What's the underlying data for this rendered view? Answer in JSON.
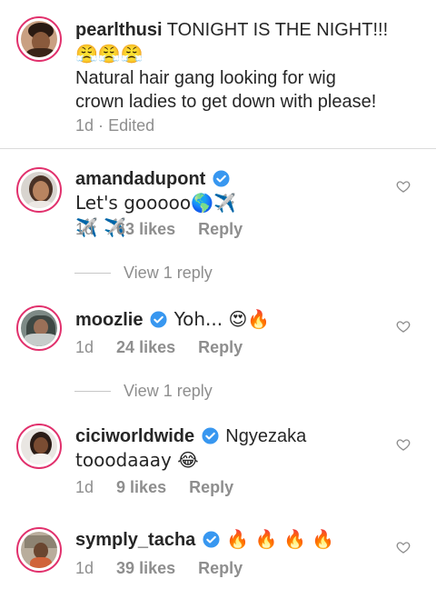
{
  "caption": {
    "username": "pearlthusi",
    "line1": "TONIGHT IS THE NIGHT!!!",
    "emojis": "😤😤😤",
    "line2": "Natural hair gang looking for wig",
    "line3": "crown ladies to get down with please!",
    "time": "1d",
    "separator": "·",
    "edited": "Edited"
  },
  "comments": [
    {
      "username": "amandadupont",
      "text1": "Let's gooooo🌎✈️",
      "text2": "✈️ ✈️",
      "time": "1d",
      "likes": "63 likes",
      "reply": "Reply",
      "view_reply": "View 1 reply"
    },
    {
      "username": "moozlie",
      "text1": "Yoh... 😍🔥",
      "time": "1d",
      "likes": "24 likes",
      "reply": "Reply",
      "view_reply": "View 1 reply"
    },
    {
      "username": "ciciworldwide",
      "text1": "Ngyezaka",
      "text2": "tooodaaay 😂",
      "time": "1d",
      "likes": "9 likes",
      "reply": "Reply"
    },
    {
      "username": "symply_tacha",
      "text1": "🔥 🔥 🔥 🔥",
      "time": "1d",
      "likes": "39 likes",
      "reply": "Reply"
    }
  ],
  "colors": {
    "verified": "#3897f0",
    "story_ring": "#e1306c",
    "meta_gray": "#8e8e8e"
  }
}
